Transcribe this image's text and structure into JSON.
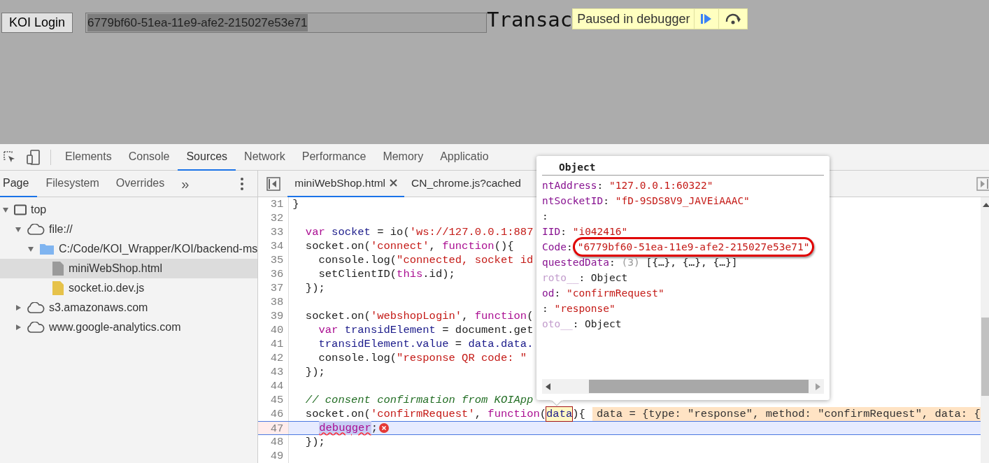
{
  "page": {
    "login_button": "KOI Login",
    "transaction_field": {
      "value": "6779bf60-51ea-11e9-afe2-215027e53e71",
      "selected": true
    },
    "heading": "Transac",
    "paused_banner": {
      "label": "Paused in debugger"
    }
  },
  "devtools": {
    "tabs": [
      {
        "label": "Elements",
        "selected": false
      },
      {
        "label": "Console",
        "selected": false
      },
      {
        "label": "Sources",
        "selected": true
      },
      {
        "label": "Network",
        "selected": false
      },
      {
        "label": "Performance",
        "selected": false
      },
      {
        "label": "Memory",
        "selected": false
      },
      {
        "label": "Applicatio",
        "selected": false
      }
    ],
    "sidebar_tabs": [
      {
        "label": "Page",
        "selected": true
      },
      {
        "label": "Filesystem",
        "selected": false
      },
      {
        "label": "Overrides",
        "selected": false
      }
    ],
    "sidebar_more": "»",
    "tree": [
      {
        "kind": "frame",
        "label": "top",
        "expanded": true,
        "selected": false,
        "children": [
          {
            "kind": "cloud",
            "label": "file://",
            "expanded": true,
            "selected": false,
            "children": [
              {
                "kind": "folder",
                "label": "C:/Code/KOI_Wrapper/KOI/backend-ms",
                "expanded": true,
                "selected": false,
                "children": [
                  {
                    "kind": "file",
                    "label": "miniWebShop.html",
                    "selected": true
                  },
                  {
                    "kind": "script",
                    "label": "socket.io.dev.js",
                    "selected": false
                  }
                ]
              }
            ]
          },
          {
            "kind": "cloud",
            "label": "s3.amazonaws.com",
            "expanded": false,
            "selected": false
          },
          {
            "kind": "cloud",
            "label": "www.google-analytics.com",
            "expanded": false,
            "selected": false
          }
        ]
      }
    ],
    "editor_tabs": [
      {
        "label": "miniWebShop.html",
        "selected": true,
        "closable": true
      },
      {
        "label": "CN_chrome.js?cached",
        "selected": false,
        "closable": false
      }
    ],
    "code_lines": [
      {
        "number": "31",
        "execution": false,
        "tokens": [
          {
            "kind": "plain",
            "text": "}"
          }
        ]
      },
      {
        "number": "32",
        "execution": false
      },
      {
        "number": "33",
        "execution": false,
        "tokens": [
          {
            "kind": "keyword",
            "text": "  var"
          },
          {
            "kind": "def",
            "text": " socket"
          },
          {
            "kind": "plain",
            "text": " = io("
          },
          {
            "kind": "string",
            "text": "'ws://127.0.0.1:887"
          }
        ]
      },
      {
        "number": "34",
        "execution": false,
        "tokens": [
          {
            "kind": "plain",
            "text": "  socket.on("
          },
          {
            "kind": "string",
            "text": "'connect'"
          },
          {
            "kind": "plain",
            "text": ", "
          },
          {
            "kind": "keyword",
            "text": "function"
          },
          {
            "kind": "plain",
            "text": "(){"
          }
        ]
      },
      {
        "number": "35",
        "execution": false,
        "tokens": [
          {
            "kind": "plain",
            "text": "    console.log("
          },
          {
            "kind": "string",
            "text": "\"connected, socket id"
          }
        ]
      },
      {
        "number": "36",
        "execution": false,
        "tokens": [
          {
            "kind": "plain",
            "text": "    setClientID("
          },
          {
            "kind": "keyword",
            "text": "this"
          },
          {
            "kind": "plain",
            "text": ".id);"
          }
        ]
      },
      {
        "number": "37",
        "execution": false,
        "tokens": [
          {
            "kind": "plain",
            "text": "  });"
          }
        ]
      },
      {
        "number": "38",
        "execution": false
      },
      {
        "number": "39",
        "execution": false,
        "tokens": [
          {
            "kind": "plain",
            "text": "  socket.on("
          },
          {
            "kind": "string",
            "text": "'webshopLogin'"
          },
          {
            "kind": "plain",
            "text": ", "
          },
          {
            "kind": "keyword",
            "text": "function"
          },
          {
            "kind": "plain",
            "text": "("
          }
        ]
      },
      {
        "number": "40",
        "execution": false,
        "tokens": [
          {
            "kind": "keyword",
            "text": "    var"
          },
          {
            "kind": "def",
            "text": " transidElement"
          },
          {
            "kind": "plain",
            "text": " = document.get"
          }
        ]
      },
      {
        "number": "41",
        "execution": false,
        "tokens": [
          {
            "kind": "def",
            "text": "    transidElement.value"
          },
          {
            "kind": "plain",
            "text": " = "
          },
          {
            "kind": "def",
            "text": "data.data."
          }
        ]
      },
      {
        "number": "42",
        "execution": false,
        "tokens": [
          {
            "kind": "plain",
            "text": "    console.log("
          },
          {
            "kind": "string",
            "text": "\"response QR code: \""
          }
        ]
      },
      {
        "number": "43",
        "execution": false,
        "tokens": [
          {
            "kind": "plain",
            "text": "  });"
          }
        ]
      },
      {
        "number": "44",
        "execution": false
      },
      {
        "number": "45",
        "execution": false,
        "tokens": [
          {
            "kind": "comment",
            "text": "  // consent confirmation from KOIApp"
          }
        ]
      },
      {
        "number": "46",
        "execution": false,
        "tokens": [
          {
            "kind": "plain",
            "text": "  socket.on("
          },
          {
            "kind": "string",
            "text": "'confirmRequest'"
          },
          {
            "kind": "plain",
            "text": ", "
          },
          {
            "kind": "keyword",
            "text": "function"
          },
          {
            "kind": "plain",
            "text": "("
          },
          {
            "kind": "hovered",
            "text": "data"
          },
          {
            "kind": "plain",
            "text": "){"
          }
        ],
        "inline_value": "data = {type: \"response\", method: \"confirmRequest\", data: {"
      },
      {
        "number": "47",
        "execution": true,
        "error": true,
        "tokens": [
          {
            "kind": "selected",
            "text": "debugger"
          },
          {
            "kind": "plain",
            "text": ";"
          }
        ]
      },
      {
        "number": "48",
        "execution": false,
        "tokens": [
          {
            "kind": "plain",
            "text": "  });"
          }
        ]
      },
      {
        "number": "49",
        "execution": false
      }
    ],
    "popover": {
      "title": "Object",
      "rows": [
        [
          {
            "kind": "key",
            "text": "ntAddress"
          },
          {
            "kind": "plain",
            "text": ": "
          },
          {
            "kind": "string",
            "text": "\"127.0.0.1:60322\""
          }
        ],
        [
          {
            "kind": "key",
            "text": "ntSocketID"
          },
          {
            "kind": "plain",
            "text": ": "
          },
          {
            "kind": "string",
            "text": "\"fD-9SDS8V9_JAVEiAAAC\""
          }
        ],
        [
          {
            "kind": "plain",
            "text": ":"
          }
        ],
        [
          {
            "kind": "key",
            "text": "IID"
          },
          {
            "kind": "plain",
            "text": ": "
          },
          {
            "kind": "string",
            "text": "\"i042416\""
          }
        ],
        [
          {
            "kind": "key",
            "text": "Code"
          },
          {
            "kind": "plain",
            "text": ":"
          },
          {
            "kind": "string",
            "text": "\"6779bf60-51ea-11e9-afe2-215027e53e71\"",
            "circled": true
          }
        ],
        [
          {
            "kind": "key",
            "text": "questedData"
          },
          {
            "kind": "plain",
            "text": ": "
          },
          {
            "kind": "count",
            "text": "(3)"
          },
          {
            "kind": "plain",
            "text": " [{…}, {…}, {…}]"
          }
        ],
        [
          {
            "kind": "proto",
            "text": "roto__"
          },
          {
            "kind": "plain",
            "text": ": Object"
          }
        ],
        [
          {
            "kind": "key",
            "text": "od"
          },
          {
            "kind": "plain",
            "text": ": "
          },
          {
            "kind": "string",
            "text": "\"confirmRequest\""
          }
        ],
        [
          {
            "kind": "plain",
            "text": ": "
          },
          {
            "kind": "string",
            "text": "\"response\""
          }
        ],
        [
          {
            "kind": "proto",
            "text": "oto__"
          },
          {
            "kind": "plain",
            "text": ": Object"
          }
        ]
      ]
    }
  }
}
